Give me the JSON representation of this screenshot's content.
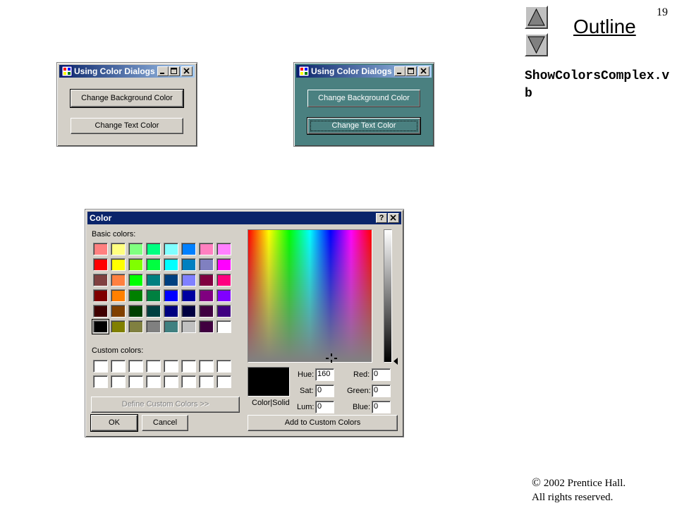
{
  "slide": {
    "page_number": "19",
    "outline_label": "Outline",
    "file_name": "ShowColorsComplex.vb",
    "copyright_symbol": "©",
    "copyright_line1": "2002 Prentice Hall.",
    "copyright_line2": "All rights reserved."
  },
  "window_left": {
    "title": "Using Color Dialogs",
    "bg_button": "Change Background Color",
    "text_button": "Change Text Color",
    "background": "#d4d0c8"
  },
  "window_right": {
    "title": "Using Color Dialogs",
    "bg_button": "Change Background Color",
    "text_button": "Change Text Color",
    "background": "#4a8080"
  },
  "color_dialog": {
    "title": "Color",
    "help_label": "?",
    "basic_colors_label": "Basic colors:",
    "custom_colors_label": "Custom colors:",
    "define_button": "Define Custom Colors >>",
    "ok_button": "OK",
    "cancel_button": "Cancel",
    "add_button": "Add to Custom Colors",
    "color_solid_label": "Color|Solid",
    "hue_label": "Hue:",
    "hue_value": "160",
    "sat_label": "Sat:",
    "sat_value": "0",
    "lum_label": "Lum:",
    "lum_value": "0",
    "red_label": "Red:",
    "red_value": "0",
    "green_label": "Green:",
    "green_value": "0",
    "blue_label": "Blue:",
    "blue_value": "0",
    "current_color": "#000000",
    "basic_colors": [
      "#ff8080",
      "#ffff80",
      "#80ff80",
      "#00ff80",
      "#80ffff",
      "#0080ff",
      "#ff80c0",
      "#ff80ff",
      "#ff0000",
      "#ffff00",
      "#80ff00",
      "#00ff40",
      "#00ffff",
      "#0080c0",
      "#8080c0",
      "#ff00ff",
      "#804040",
      "#ff8040",
      "#00ff00",
      "#008080",
      "#004080",
      "#8080ff",
      "#800040",
      "#ff0080",
      "#800000",
      "#ff8000",
      "#008000",
      "#008040",
      "#0000ff",
      "#0000a0",
      "#800080",
      "#8000ff",
      "#400000",
      "#804000",
      "#004000",
      "#004040",
      "#000080",
      "#000040",
      "#400040",
      "#400080",
      "#000000",
      "#808000",
      "#808040",
      "#808080",
      "#408080",
      "#c0c0c0",
      "#400040",
      "#ffffff"
    ],
    "selected_basic_index": 40,
    "custom_colors": [
      "#ffffff",
      "#ffffff",
      "#ffffff",
      "#ffffff",
      "#ffffff",
      "#ffffff",
      "#ffffff",
      "#ffffff",
      "#ffffff",
      "#ffffff",
      "#ffffff",
      "#ffffff",
      "#ffffff",
      "#ffffff",
      "#ffffff",
      "#ffffff"
    ]
  }
}
